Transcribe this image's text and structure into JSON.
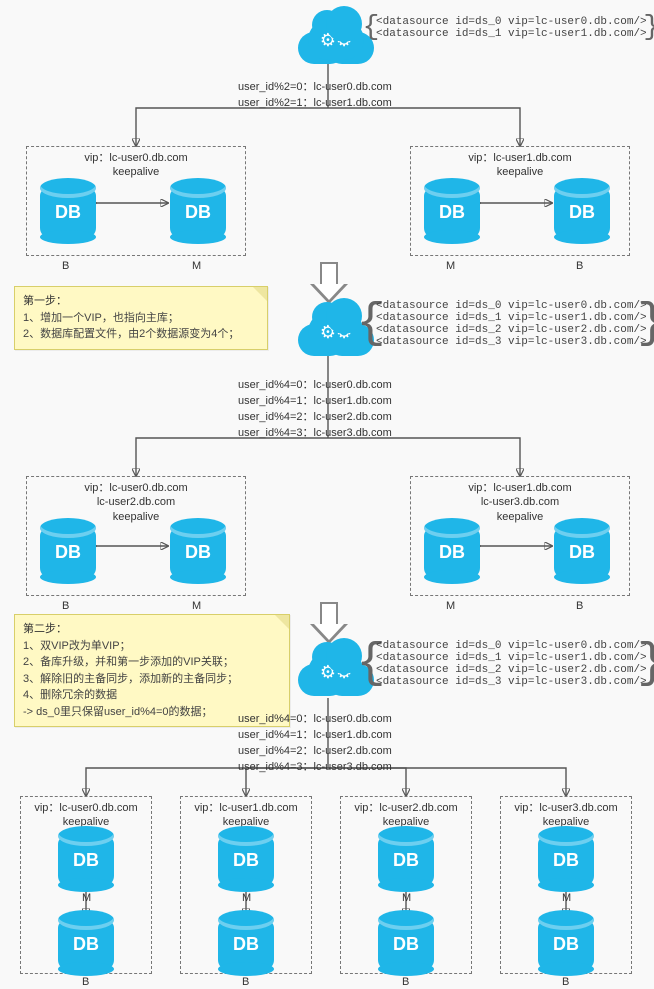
{
  "db_label": "DB",
  "role": {
    "master": "M",
    "backup": "B"
  },
  "clouds": {
    "top": {
      "datasources": [
        "<datasource id=ds_0 vip=lc-user0.db.com/>",
        "<datasource id=ds_1 vip=lc-user1.db.com/>"
      ]
    },
    "mid": {
      "datasources": [
        "<datasource id=ds_0 vip=lc-user0.db.com/>",
        "<datasource id=ds_1 vip=lc-user1.db.com/>",
        "<datasource id=ds_2 vip=lc-user2.db.com/>",
        "<datasource id=ds_3 vip=lc-user3.db.com/>"
      ]
    },
    "bot": {
      "datasources": [
        "<datasource id=ds_0 vip=lc-user0.db.com/>",
        "<datasource id=ds_1 vip=lc-user1.db.com/>",
        "<datasource id=ds_2 vip=lc-user2.db.com/>",
        "<datasource id=ds_3 vip=lc-user3.db.com/>"
      ]
    }
  },
  "rules": {
    "top": [
      "user_id%2=0：lc-user0.db.com",
      "user_id%2=1：lc-user1.db.com"
    ],
    "mid": [
      "user_id%4=0：lc-user0.db.com",
      "user_id%4=1：lc-user1.db.com",
      "user_id%4=2：lc-user2.db.com",
      "user_id%4=3：lc-user3.db.com"
    ],
    "bot": [
      "user_id%4=0：lc-user0.db.com",
      "user_id%4=1：lc-user1.db.com",
      "user_id%4=2：lc-user2.db.com",
      "user_id%4=3：lc-user3.db.com"
    ]
  },
  "groups": {
    "stage1_left": {
      "line1": "vip：lc-user0.db.com",
      "line2": "keepalive"
    },
    "stage1_right": {
      "line1": "vip：lc-user1.db.com",
      "line2": "keepalive"
    },
    "stage2_left": {
      "line1": "vip：lc-user0.db.com",
      "line2": "lc-user2.db.com",
      "line3": "keepalive"
    },
    "stage2_right": {
      "line1": "vip：lc-user1.db.com",
      "line2": "lc-user3.db.com",
      "line3": "keepalive"
    },
    "final_0": {
      "line1": "vip：lc-user0.db.com",
      "line2": "keepalive"
    },
    "final_1": {
      "line1": "vip：lc-user1.db.com",
      "line2": "keepalive"
    },
    "final_2": {
      "line1": "vip：lc-user2.db.com",
      "line2": "keepalive"
    },
    "final_3": {
      "line1": "vip：lc-user3.db.com",
      "line2": "keepalive"
    }
  },
  "notes": {
    "step1": {
      "header": "第一步：",
      "lines": [
        "1、增加一个VIP，也指向主库；",
        "2、数据库配置文件，由2个数据源变为4个；"
      ]
    },
    "step2": {
      "header": "第二步：",
      "lines": [
        "1、双VIP改为单VIP；",
        "2、备库升级，并和第一步添加的VIP关联；",
        "3、解除旧的主备同步，添加新的主备同步；",
        "4、删除冗余的数据",
        "       -> ds_0里只保留user_id%4=0的数据；"
      ]
    }
  }
}
